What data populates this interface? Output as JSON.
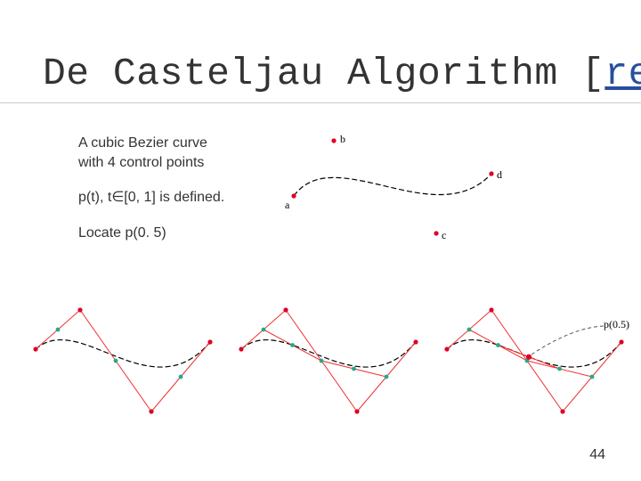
{
  "title": {
    "prefix": "De Casteljau Algorithm ",
    "bracket_open": "[",
    "ref_text": "ref",
    "bracket_close": "]"
  },
  "body": {
    "line1": "A cubic Bezier curve",
    "line2": "with 4 control points",
    "line3": "p(t), t∈[0, 1] is defined.",
    "line4": "Locate p(0. 5)"
  },
  "fig_top": {
    "labels": {
      "a": "a",
      "b": "b",
      "c": "c",
      "d": "d"
    }
  },
  "fig_right": {
    "result_label": "p(0.5)"
  },
  "page_number": "44"
}
